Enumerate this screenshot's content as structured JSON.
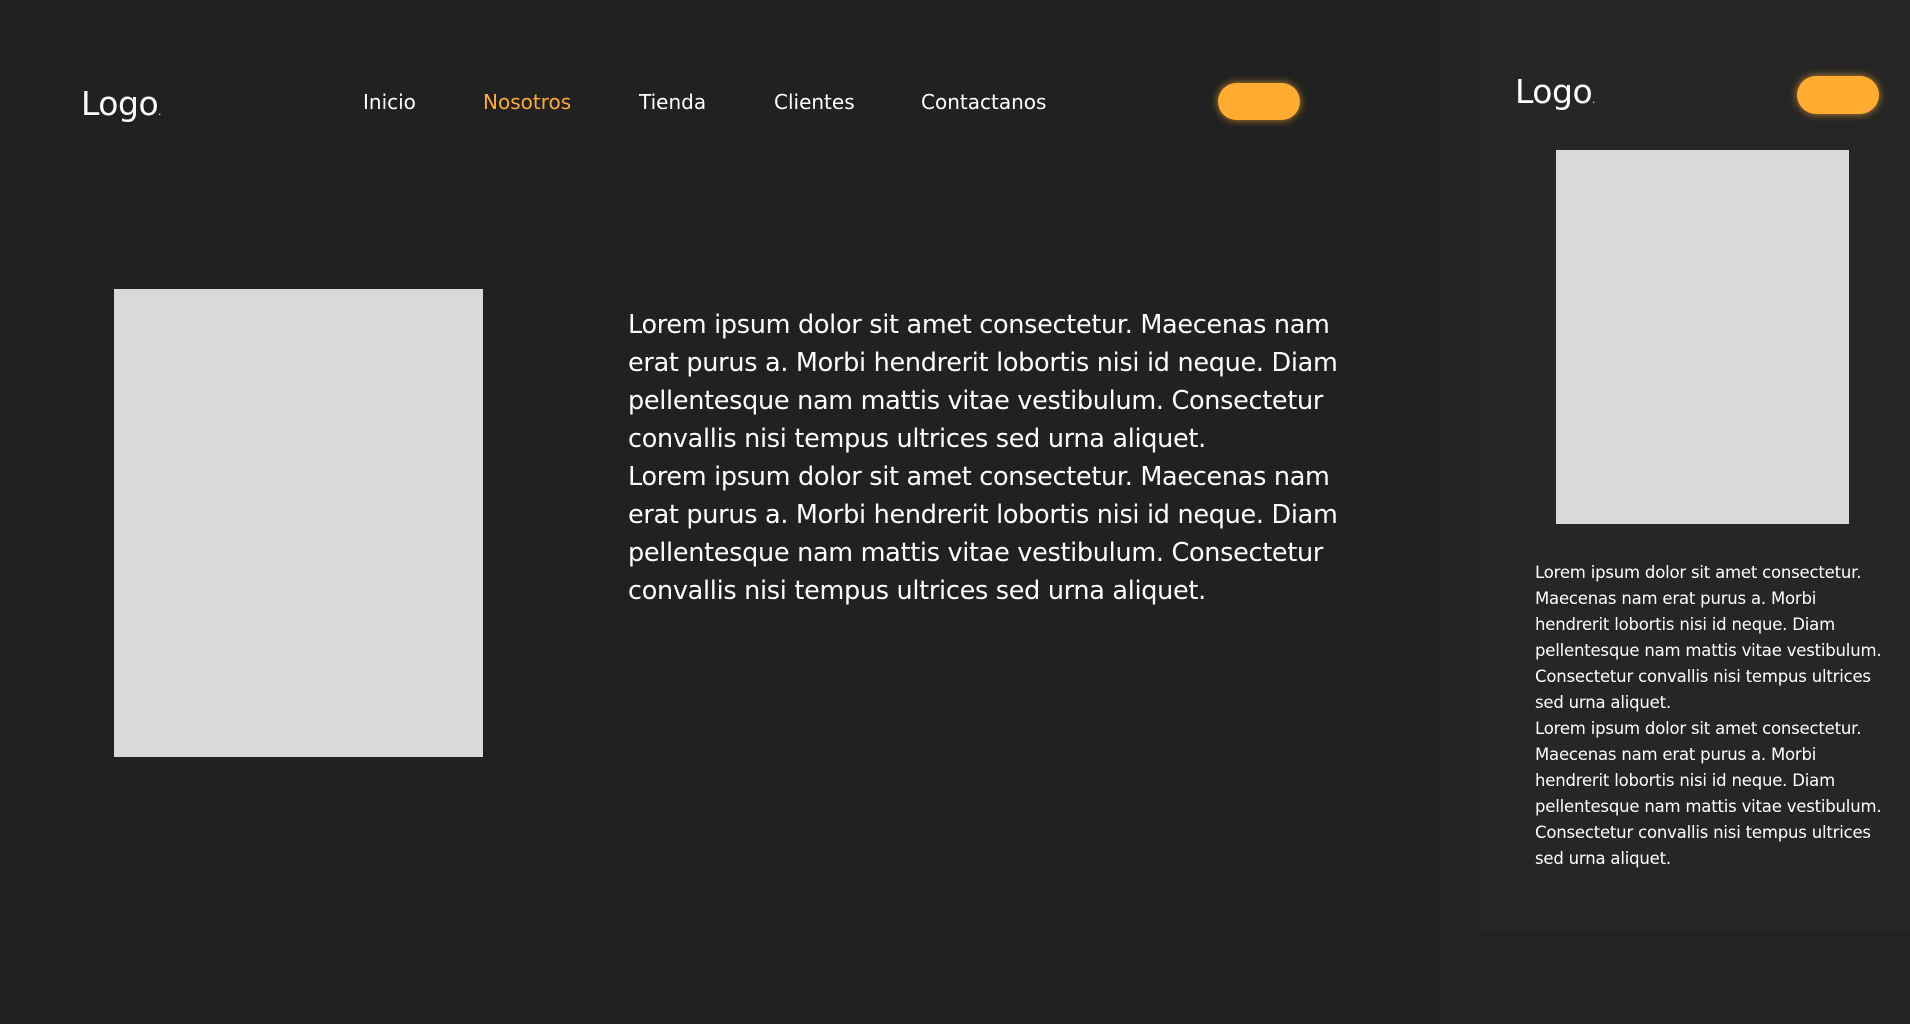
{
  "desktop": {
    "logo": "Logo",
    "logo_dot": ".",
    "nav": [
      {
        "label": "Inicio",
        "active": false
      },
      {
        "label": "Nosotros",
        "active": true
      },
      {
        "label": "Tienda",
        "active": false
      },
      {
        "label": "Clientes",
        "active": false
      },
      {
        "label": "Contactanos",
        "active": false
      }
    ],
    "body_paragraphs": [
      "Lorem ipsum dolor sit amet consectetur. Maecenas nam erat purus a. Morbi hendrerit lobortis nisi id neque. Diam pellentesque nam mattis vitae vestibulum. Consectetur convallis nisi tempus ultrices sed urna aliquet.",
      "Lorem ipsum dolor sit amet consectetur. Maecenas nam erat purus a. Morbi hendrerit lobortis nisi id neque. Diam pellentesque nam mattis vitae vestibulum. Consectetur convallis nisi tempus ultrices sed urna aliquet."
    ]
  },
  "mobile": {
    "logo": "Logo",
    "logo_dot": ".",
    "body_paragraphs": [
      "Lorem ipsum dolor sit amet consectetur. Maecenas nam erat purus a. Morbi hendrerit lobortis nisi id neque. Diam pellentesque nam mattis vitae vestibulum. Consectetur convallis nisi tempus ultrices sed urna aliquet.",
      "Lorem ipsum dolor sit amet consectetur. Maecenas nam erat purus a. Morbi hendrerit lobortis nisi id neque. Diam pellentesque nam mattis vitae vestibulum. Consectetur convallis nisi tempus ultrices sed urna aliquet."
    ]
  },
  "colors": {
    "background": "#212121",
    "accent": "#ffac30",
    "text": "#ffffff",
    "placeholder": "#d9d9d9"
  }
}
